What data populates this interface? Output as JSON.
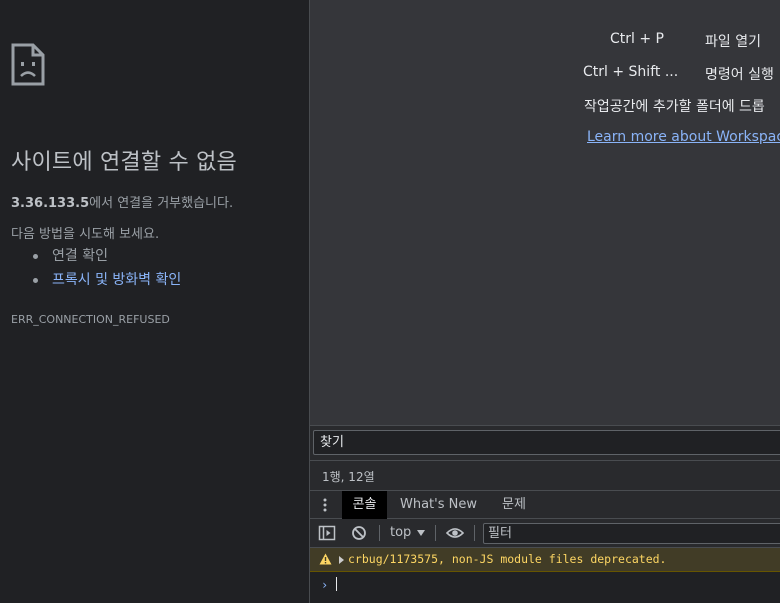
{
  "error_page": {
    "title": "사이트에 연결할 수 없음",
    "host": "3.36.133.5",
    "desc_suffix": "에서 연결을 거부했습니다.",
    "try_text": "다음 방법을 시도해 보세요.",
    "suggestions": [
      "연결 확인",
      "프록시 및 방화벽 확인"
    ],
    "error_code": "ERR_CONNECTION_REFUSED"
  },
  "sources_panel": {
    "shortcuts": [
      {
        "keys": "Ctrl + P",
        "label": "파일 열기"
      },
      {
        "keys": "Ctrl + Shift ...",
        "label": "명령어 실행"
      }
    ],
    "drop_hint": "작업공간에 추가할 폴더에 드롭",
    "workspace_link": "Learn more about Workspaces",
    "search_placeholder": "찾기",
    "status": "1행, 12열"
  },
  "drawer": {
    "tabs": [
      "콘솔",
      "What's New",
      "문제"
    ],
    "context": "top",
    "filter_placeholder": "필터"
  },
  "console": {
    "warning": "crbug/1173575, non-JS module files deprecated.",
    "prompt_symbol": "›"
  },
  "colors": {
    "link": "#8ab4f8",
    "warning_text": "#fdd663",
    "warning_bg": "#413c26"
  }
}
